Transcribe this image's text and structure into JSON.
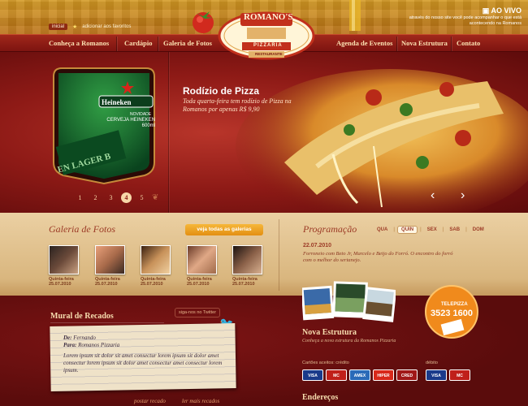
{
  "top": {
    "inicio": "inicial",
    "favoritos": "adicionar aos favoritos",
    "live_title": "AO VIVO",
    "live_desc": "através do nosso site você pode acompanhar o que está acontecendo na Romanos"
  },
  "logo": {
    "name": "ROMANO'S",
    "sub1": "PIZZARIA",
    "sub2": "RESTAURANTE"
  },
  "nav": {
    "items": [
      "Conheça a Romanos",
      "Cardápio",
      "Galeria de Fotos",
      "Agenda de Eventos",
      "Nova Estrutura",
      "Contato"
    ]
  },
  "hero": {
    "ad_brand": "Heineken",
    "ad_tag": "NOVIDADE",
    "ad_desc": "CERVEJA HEINEKEN 600ml",
    "ad_bottle": "EN LAGER B",
    "slides": [
      "1",
      "2",
      "3",
      "4",
      "5"
    ],
    "active_slide": "4",
    "title": "Rodízio de Pizza",
    "desc": "Toda quarta-feira tem rodízio de Pizza na Romanos por apenas R$ 9,90",
    "prev": "‹",
    "next": "›"
  },
  "gallery": {
    "title": "Galeria de Fotos",
    "button": "veja todas as galerias",
    "items": [
      {
        "day": "Quinta-feira",
        "date": "25.07.2010"
      },
      {
        "day": "Quinta-feira",
        "date": "25.07.2010"
      },
      {
        "day": "Quinta-feira",
        "date": "25.07.2010"
      },
      {
        "day": "Quinta-feira",
        "date": "25.07.2010"
      },
      {
        "day": "Quinta-feira",
        "date": "25.07.2010"
      }
    ]
  },
  "programacao": {
    "title": "Programação",
    "days": [
      "QUA",
      "QUIN",
      "SEX",
      "SAB",
      "DOM"
    ],
    "selected": "QUIN",
    "date": "22.07.2010",
    "text": "Forroneio com Beto Jr, Marcelo e Beijo do Forró. O encontro do forró com o melhor do sertanejo."
  },
  "mural": {
    "title": "Mural de Recados",
    "twitter": "siga-nos no Twitter",
    "de_label": "De:",
    "de": "Fernando",
    "para_label": "Para:",
    "para": "Romanos Pizzaria",
    "msg": "Lorem ipsum sit dolor sit amet consectur lorem ipsum sit dolor amet consectur lorem ipsum sit dolor amet consectur amet consectur lorem ipsum.",
    "post": "postar recado",
    "more": "ler mais recados"
  },
  "nova_estrutura": {
    "title": "Nova Estrutura",
    "desc": "Conheça a nova estrutura da Romanos Pizzaria"
  },
  "telepizza": {
    "label": "TELEPIZZA",
    "phone": "3523 1600"
  },
  "cards": {
    "credit_label": "Cartões aceitos: crédito",
    "debit_label": "débito",
    "credit": [
      "VISA",
      "MC",
      "AMEX",
      "HIPER",
      "CRED"
    ],
    "debit": [
      "VISA",
      "MC"
    ]
  },
  "enderecos": {
    "title": "Endereços"
  }
}
